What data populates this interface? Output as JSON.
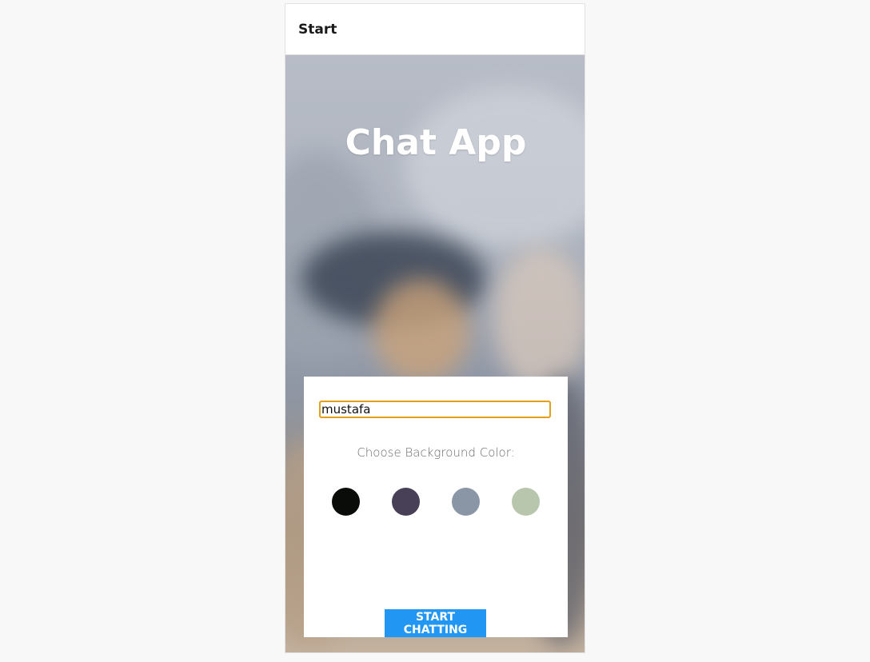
{
  "header": {
    "title": "Start"
  },
  "hero": {
    "title": "Chat App"
  },
  "form": {
    "name_value": "mustafa",
    "color_label": "Choose Background Color:",
    "colors": [
      {
        "name": "black",
        "hex": "#090C08"
      },
      {
        "name": "purple",
        "hex": "#474056"
      },
      {
        "name": "grey",
        "hex": "#8A95A5"
      },
      {
        "name": "green",
        "hex": "#B9C6AE"
      }
    ],
    "start_label": "START CHATTING"
  },
  "theme": {
    "accent": "#2196F3",
    "input_focus_border": "#E39F1A"
  }
}
